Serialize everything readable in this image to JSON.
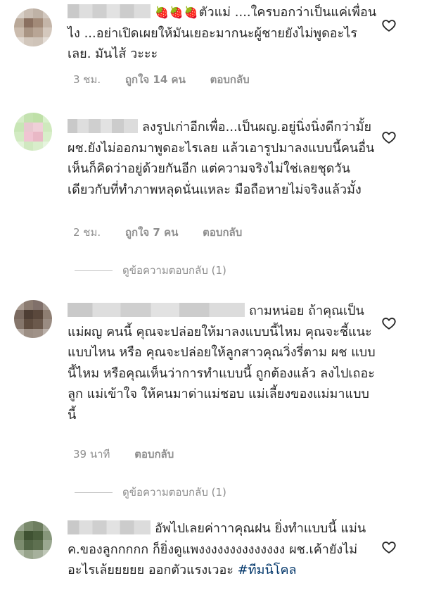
{
  "comments": [
    {
      "pre_emoji": "🍓🍓🍓",
      "text": "ตัวแม่ ....ใครบอกว่าเป็นแค่เพื่อนไง ...อย่าเปิดเผยให้มันเยอะมากนะผู้ชายยังไม่พูดอะไรเลย. มันไส้ วะะะ",
      "time": "3 ชม.",
      "likes": "ถูกใจ 14 คน",
      "reply": "ตอบกลับ"
    },
    {
      "text": "ลงรูปเก่าอีกเพื่อ...เป็นผญ.อยู่นิ่งนิ่งดีกว่ามั้ย ผช.ยังไม่ออกมาพูดอะไรเลย แล้วเอารูปมาลงแบบนี้คนอื่นเห็นก็คิดว่าอยู่ด้วยกันอีก แต่ความจริงไม่ใช่เลยชุดวันเดียวกับที่ทำภาพหลุดนั่นแหละ มือถือหายไม่จริงแล้วมั้ง",
      "time": "2 ชม.",
      "likes": "ถูกใจ 7 คน",
      "reply": "ตอบกลับ",
      "view_replies": "ดูข้อความตอบกลับ (1)"
    },
    {
      "text": "ถามหน่อย ถ้าคุณเป็นแม่ผญ คนนี้ คุณจะปล่อยให้มาลงแบบนี้ไหม คุณจะชี้แนะแบบไหน หรือ คุณจะปล่อยให้ลูกสาวคุณวิ่งรี่ตาม ผช แบบนี้ไหม หรือคุณเห็นว่าการทำแบบนี้ ถูกต้องแล้ว ลงไปเถอะลูก แม่เข้าใจ ให้คนมาด่าแม่ชอบ แม่เลี้ยงของแม่มาแบบนี้",
      "time": "39 นาที",
      "reply": "ตอบกลับ",
      "view_replies": "ดูข้อความตอบกลับ (1)"
    },
    {
      "text": "อัพไปเลยค่าาาคุณฝน ยิ่งทำแบบนี้ แม่นค.ของลูกกกกก ก็ยิ่งดูแพงงงงงงงงงงงงงง ผช.เค้ายังไม่อะไรเล้ยยยยย ออกตัวแรงเวอะ",
      "hashtag": "#ทีมนิโคล"
    }
  ],
  "colors": {
    "meta": "#8e8e8e",
    "text": "#262626",
    "hashtag": "#003569"
  },
  "icons": [
    "heart-outline-icon"
  ]
}
